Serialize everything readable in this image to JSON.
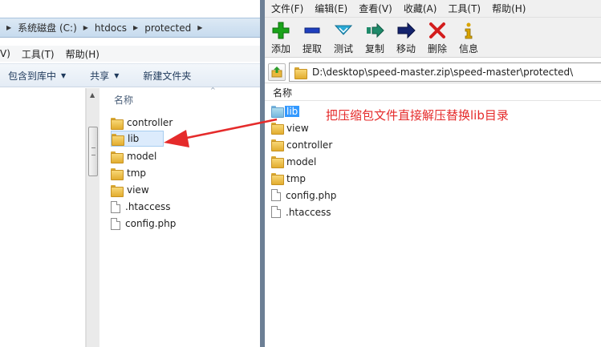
{
  "explorer": {
    "breadcrumb": [
      "系统磁盘 (C:)",
      "htdocs",
      "protected"
    ],
    "menubar": [
      "V)",
      "工具(T)",
      "帮助(H)"
    ],
    "toolbar": [
      {
        "label": "包含到库中",
        "dropdown": true
      },
      {
        "label": "共享",
        "dropdown": true
      },
      {
        "label": "新建文件夹",
        "dropdown": false
      }
    ],
    "column_header": "名称",
    "files": [
      {
        "name": "controller",
        "type": "folder",
        "selected": false
      },
      {
        "name": "lib",
        "type": "folder",
        "selected": true
      },
      {
        "name": "model",
        "type": "folder",
        "selected": false
      },
      {
        "name": "tmp",
        "type": "folder",
        "selected": false
      },
      {
        "name": "view",
        "type": "folder",
        "selected": false
      },
      {
        "name": ".htaccess",
        "type": "file",
        "selected": false
      },
      {
        "name": "config.php",
        "type": "file",
        "selected": false
      }
    ]
  },
  "winrar": {
    "menubar": [
      "文件(F)",
      "编辑(E)",
      "查看(V)",
      "收藏(A)",
      "工具(T)",
      "帮助(H)"
    ],
    "toolbar": [
      {
        "label": "添加",
        "icon": "plus-icon",
        "color": "#1aa31a"
      },
      {
        "label": "提取",
        "icon": "minus-icon",
        "color": "#1f3fbf"
      },
      {
        "label": "测试",
        "icon": "check-chevron-icon",
        "color": "#2aa9d6"
      },
      {
        "label": "复制",
        "icon": "copy-arrow-icon",
        "color": "#1f8a6a"
      },
      {
        "label": "移动",
        "icon": "move-arrow-icon",
        "color": "#14236e"
      },
      {
        "label": "删除",
        "icon": "delete-x-icon",
        "color": "#d31d1d"
      },
      {
        "label": "信息",
        "icon": "info-icon",
        "color": "#d9a400"
      }
    ],
    "path": "D:\\desktop\\speed-master.zip\\speed-master\\protected\\",
    "column_header": "名称",
    "files": [
      {
        "name": "lib",
        "type": "folder",
        "selected": true
      },
      {
        "name": "view",
        "type": "folder",
        "selected": false
      },
      {
        "name": "controller",
        "type": "folder",
        "selected": false
      },
      {
        "name": "model",
        "type": "folder",
        "selected": false
      },
      {
        "name": "tmp",
        "type": "folder",
        "selected": false
      },
      {
        "name": "config.php",
        "type": "file",
        "selected": false
      },
      {
        "name": ".htaccess",
        "type": "file",
        "selected": false
      }
    ]
  },
  "annotation": {
    "text": "把压缩包文件直接解压替换lib目录",
    "color": "#e52b2b"
  }
}
